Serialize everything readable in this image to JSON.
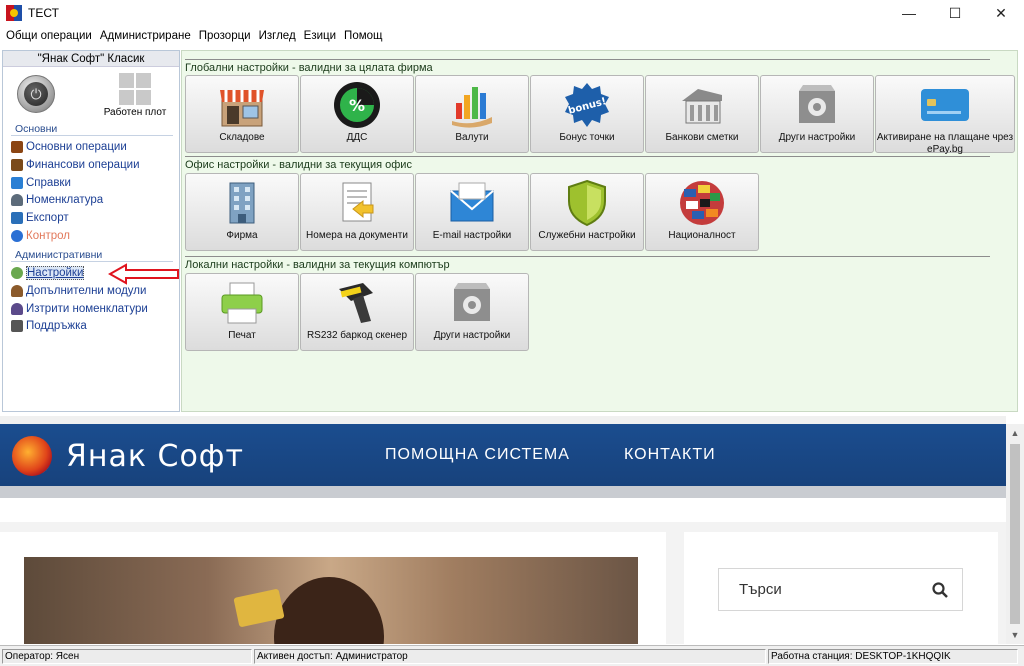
{
  "window": {
    "title": "ТЕСТ",
    "controls": {
      "minimize": "—",
      "maximize": "☐",
      "close": "✕"
    }
  },
  "menu": [
    "Общи операции",
    "Администриране",
    "Прозорци",
    "Изглед",
    "Езици",
    "Помощ"
  ],
  "left_panel": {
    "header": "\"Янак Софт\" Класик",
    "desktop_label": "Работен плот",
    "section_main": "Основни",
    "main_items": [
      {
        "label": "Основни операции",
        "icon": "book-icon",
        "color": "#8b4513"
      },
      {
        "label": "Финансови операции",
        "icon": "money-icon",
        "color": "#7a4a1a"
      },
      {
        "label": "Справки",
        "icon": "chart-icon",
        "color": "#2a7fd4"
      },
      {
        "label": "Номенклатура",
        "icon": "person-icon",
        "color": "#5c6b7a"
      },
      {
        "label": "Експорт",
        "icon": "export-icon",
        "color": "#2a6fb8"
      },
      {
        "label": "Контрол",
        "icon": "info-icon",
        "color": "#2a6fd4"
      }
    ],
    "section_admin": "Административни",
    "admin_items": [
      {
        "label": "Настройки",
        "icon": "gear-icon",
        "color": "#6aa84f"
      },
      {
        "label": "Допълнителни модули",
        "icon": "person-icon",
        "color": "#8b5a2b"
      },
      {
        "label": "Изтрити номенклатури",
        "icon": "person-delete-icon",
        "color": "#5b4a8a"
      },
      {
        "label": "Поддръжка",
        "icon": "tools-icon",
        "color": "#555555"
      }
    ]
  },
  "groups": [
    {
      "title": "Глобални настройки - валидни за цялата фирма",
      "tiles": [
        {
          "label": "Складове",
          "icon": "store-icon"
        },
        {
          "label": "ДДС",
          "icon": "percent-icon"
        },
        {
          "label": "Валути",
          "icon": "currency-chart-icon"
        },
        {
          "label": "Бонус точки",
          "icon": "bonus-badge-icon"
        },
        {
          "label": "Банкови сметки",
          "icon": "bank-icon"
        },
        {
          "label": "Други настройки",
          "icon": "settings-box-icon"
        },
        {
          "label": "Активиране на плащане чрез ePay.bg",
          "icon": "card-icon"
        }
      ]
    },
    {
      "title": "Офис настройки - валидни за текущия офис",
      "tiles": [
        {
          "label": "Фирма",
          "icon": "building-icon"
        },
        {
          "label": "Номера на документи",
          "icon": "document-icon"
        },
        {
          "label": "E-mail настройки",
          "icon": "mail-icon"
        },
        {
          "label": "Служебни настройки",
          "icon": "shield-icon"
        },
        {
          "label": "Националност",
          "icon": "globe-flags-icon"
        }
      ]
    },
    {
      "title": "Локални настройки - валидни за текущия компютър",
      "tiles": [
        {
          "label": "Печат",
          "icon": "printer-icon"
        },
        {
          "label": "RS232 баркод скенер",
          "icon": "barcode-scanner-icon"
        },
        {
          "label": "Други настройки",
          "icon": "settings-box-icon"
        }
      ]
    }
  ],
  "web": {
    "brand": "Янак Софт",
    "nav": [
      "ПОМОЩНА СИСТЕМА",
      "КОНТАКТИ"
    ],
    "search_placeholder": "Търси"
  },
  "status": {
    "operator": "Оператор: Ясен",
    "access": "Активен достъп: Администратор",
    "station": "Работна станция:  DESKTOP-1KHQQIK"
  },
  "colors": {
    "main_panel_bg": "#eef9ea",
    "banner": "#1b4d8f",
    "annotation_arrow": "#e0141e"
  }
}
